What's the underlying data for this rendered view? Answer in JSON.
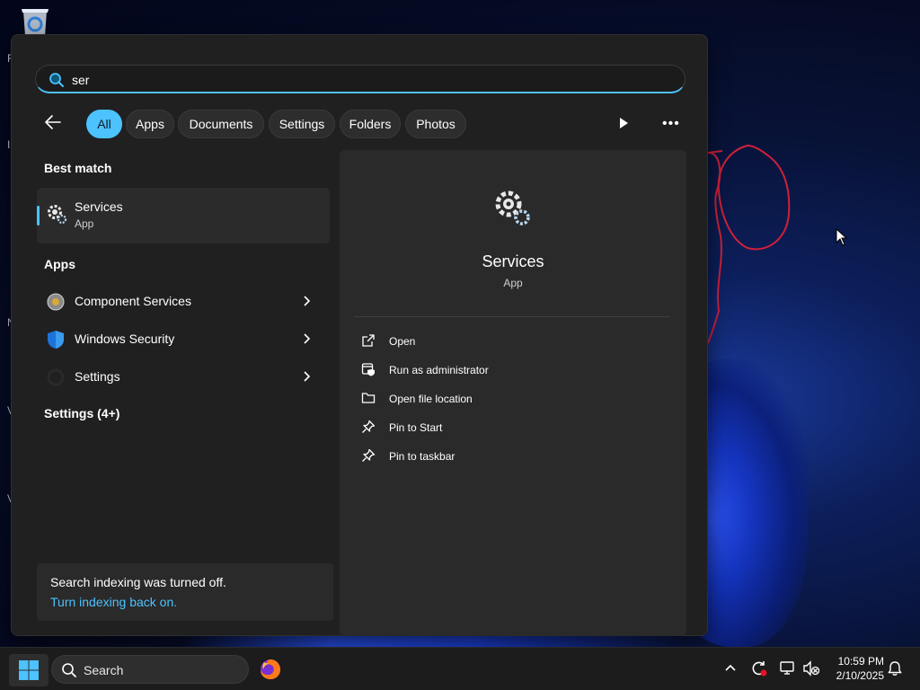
{
  "search": {
    "query": "ser"
  },
  "filters": [
    "All",
    "Apps",
    "Documents",
    "Settings",
    "Folders",
    "Photos"
  ],
  "best_match": {
    "heading": "Best match",
    "name": "Services",
    "type": "App"
  },
  "apps": {
    "heading": "Apps",
    "items": [
      {
        "name": "Component Services"
      },
      {
        "name": "Windows Security"
      },
      {
        "name": "Settings"
      }
    ]
  },
  "settings_more": "Settings (4+)",
  "indexing": {
    "message": "Search indexing was turned off.",
    "link": "Turn indexing back on."
  },
  "detail": {
    "title": "Services",
    "subtitle": "App",
    "actions": [
      "Open",
      "Run as administrator",
      "Open file location",
      "Pin to Start",
      "Pin to taskbar"
    ]
  },
  "taskbar": {
    "search_label": "Search",
    "time": "10:59 PM",
    "date": "2/10/2025"
  },
  "colors": {
    "accent": "#4cc2ff",
    "panel": "#202020",
    "taskbar": "#1c1c1c"
  }
}
